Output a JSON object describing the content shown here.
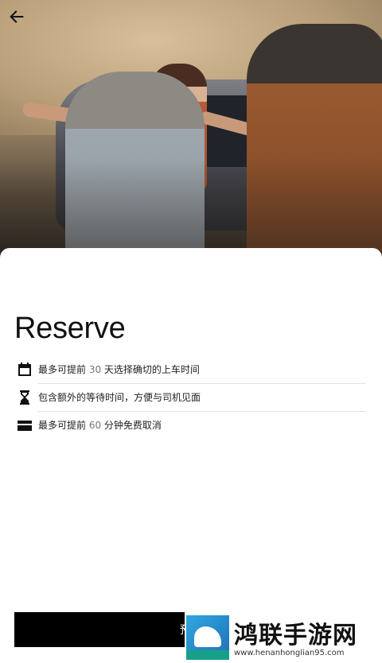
{
  "header": {
    "back_icon": "arrow-left-icon"
  },
  "hero": {
    "image": "photo: woman greeting elderly passengers at car"
  },
  "sheet": {
    "title": "Reserve",
    "features": [
      {
        "icon": "calendar-icon",
        "prefix": "最多可提前 ",
        "num": "30",
        "suffix": " 天选择确切的上车时间"
      },
      {
        "icon": "hourglass-icon",
        "prefix": "包含额外的等待时间，方便与司机见面",
        "num": "",
        "suffix": ""
      },
      {
        "icon": "credit-card-icon",
        "prefix": "最多可提前 ",
        "num": "60",
        "suffix": " 分钟免费取消"
      }
    ]
  },
  "footer": {
    "reserve_label": "预约"
  },
  "watermark": {
    "title": "鸿联手游网",
    "url": "www.henanhonglian95.com"
  },
  "colors": {
    "button_bg": "#000000",
    "text": "#111111",
    "muted_number": "#757575"
  }
}
